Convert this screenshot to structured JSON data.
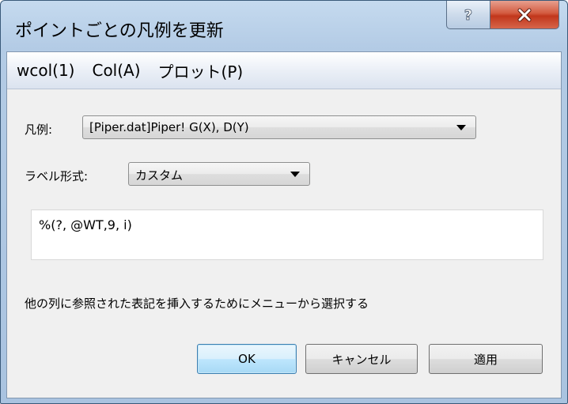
{
  "window": {
    "title": "ポイントごとの凡例を更新",
    "help_glyph": "?",
    "close_glyph": "X"
  },
  "menu": {
    "items": [
      {
        "label": "wcol(1)"
      },
      {
        "label": "Col(A)"
      },
      {
        "label": "プロット(P)"
      }
    ]
  },
  "legend": {
    "label": "凡例:",
    "value": "[Piper.dat]Piper! G(X), D(Y)"
  },
  "label_format": {
    "label": "ラベル形式:",
    "value": "カスタム"
  },
  "expression": {
    "value": "%(?, @WT,9, i)"
  },
  "hint": "他の列に参照された表記を挿入するためにメニューから選択する",
  "buttons": {
    "ok": "OK",
    "cancel": "キャンセル",
    "apply": "適用"
  },
  "colors": {
    "title_bar": "#b3cbe5",
    "close_button": "#c1361b",
    "default_button_border": "#3c7fb1"
  }
}
